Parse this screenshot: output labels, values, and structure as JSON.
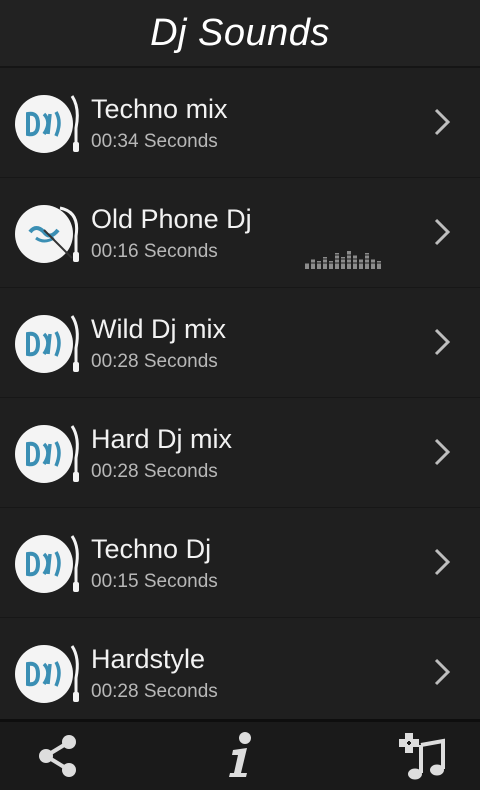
{
  "header": {
    "title": "Dj Sounds"
  },
  "songs": [
    {
      "title": "Techno mix",
      "duration": "00:34 Seconds",
      "playing": false
    },
    {
      "title": "Old Phone Dj",
      "duration": "00:16 Seconds",
      "playing": true
    },
    {
      "title": "Wild Dj mix",
      "duration": "00:28 Seconds",
      "playing": false
    },
    {
      "title": "Hard Dj mix",
      "duration": "00:28 Seconds",
      "playing": false
    },
    {
      "title": "Techno Dj",
      "duration": "00:15 Seconds",
      "playing": false
    },
    {
      "title": "Hardstyle",
      "duration": "00:28 Seconds",
      "playing": false
    }
  ],
  "footer": {
    "icons": [
      "share-icon",
      "info-icon",
      "add-music-icon"
    ]
  },
  "colors": {
    "background": "#1f1f1f",
    "logo_blue": "#3b8fb4",
    "text": "#f2f2f2",
    "subtext": "#b8b8b8"
  }
}
